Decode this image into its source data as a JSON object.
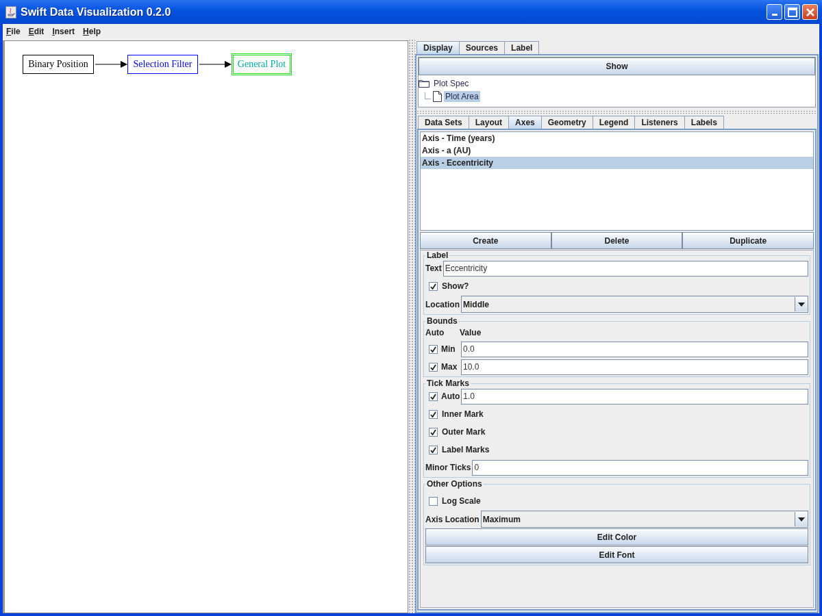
{
  "window": {
    "title": "Swift Data Visualization 0.2.0"
  },
  "menu": [
    {
      "label": "File"
    },
    {
      "label": "Edit"
    },
    {
      "label": "Insert"
    },
    {
      "label": "Help"
    }
  ],
  "diagram": {
    "nodes": [
      {
        "label": "Binary Position",
        "color": "#000000",
        "selected": false
      },
      {
        "label": "Selection Filter",
        "color": "#0000ff",
        "selected": false
      },
      {
        "label": "General Plot",
        "color": "#00a8a0",
        "selected": true
      }
    ]
  },
  "top_tabs": [
    {
      "label": "Display",
      "selected": true
    },
    {
      "label": "Sources",
      "selected": false
    },
    {
      "label": "Label",
      "selected": false
    }
  ],
  "show_button": "Show",
  "tree": [
    {
      "label": "Plot Spec",
      "kind": "folder",
      "selected": false,
      "children": [
        {
          "label": "Plot Area",
          "kind": "file",
          "selected": true
        }
      ]
    }
  ],
  "editor_tabs": [
    {
      "label": "Data Sets",
      "selected": false
    },
    {
      "label": "Layout",
      "selected": false
    },
    {
      "label": "Axes",
      "selected": true
    },
    {
      "label": "Geometry",
      "selected": false
    },
    {
      "label": "Legend",
      "selected": false
    },
    {
      "label": "Listeners",
      "selected": false
    },
    {
      "label": "Labels",
      "selected": false
    }
  ],
  "axes_list": [
    {
      "label": "Axis - Time (years)",
      "selected": false
    },
    {
      "label": "Axis - a (AU)",
      "selected": false
    },
    {
      "label": "Axis - Eccentricity",
      "selected": true
    }
  ],
  "list_buttons": [
    "Create",
    "Delete",
    "Duplicate"
  ],
  "label_group": {
    "title": "Label",
    "text_label": "Text",
    "text_value": "Eccentricity",
    "show": {
      "label": "Show?",
      "checked": true
    },
    "location_label": "Location",
    "location_value": "Middle"
  },
  "bounds": {
    "title": "Bounds",
    "auto_header": "Auto",
    "value_header": "Value",
    "rows": [
      {
        "label": "Min",
        "checked": true,
        "value": "0.0"
      },
      {
        "label": "Max",
        "checked": true,
        "value": "10.0"
      }
    ]
  },
  "tick_marks": {
    "title": "Tick Marks",
    "auto": {
      "label": "Auto",
      "checked": true,
      "value": "1.0"
    },
    "checks": [
      {
        "label": "Inner Mark",
        "checked": true
      },
      {
        "label": "Outer Mark",
        "checked": true
      },
      {
        "label": "Label Marks",
        "checked": true
      }
    ],
    "minor_label": "Minor Ticks",
    "minor_value": "0"
  },
  "other": {
    "title": "Other Options",
    "log_scale": {
      "label": "Log Scale",
      "checked": false
    },
    "axis_location_label": "Axis Location",
    "axis_location_value": "Maximum",
    "buttons": [
      "Edit Color",
      "Edit Font"
    ]
  }
}
